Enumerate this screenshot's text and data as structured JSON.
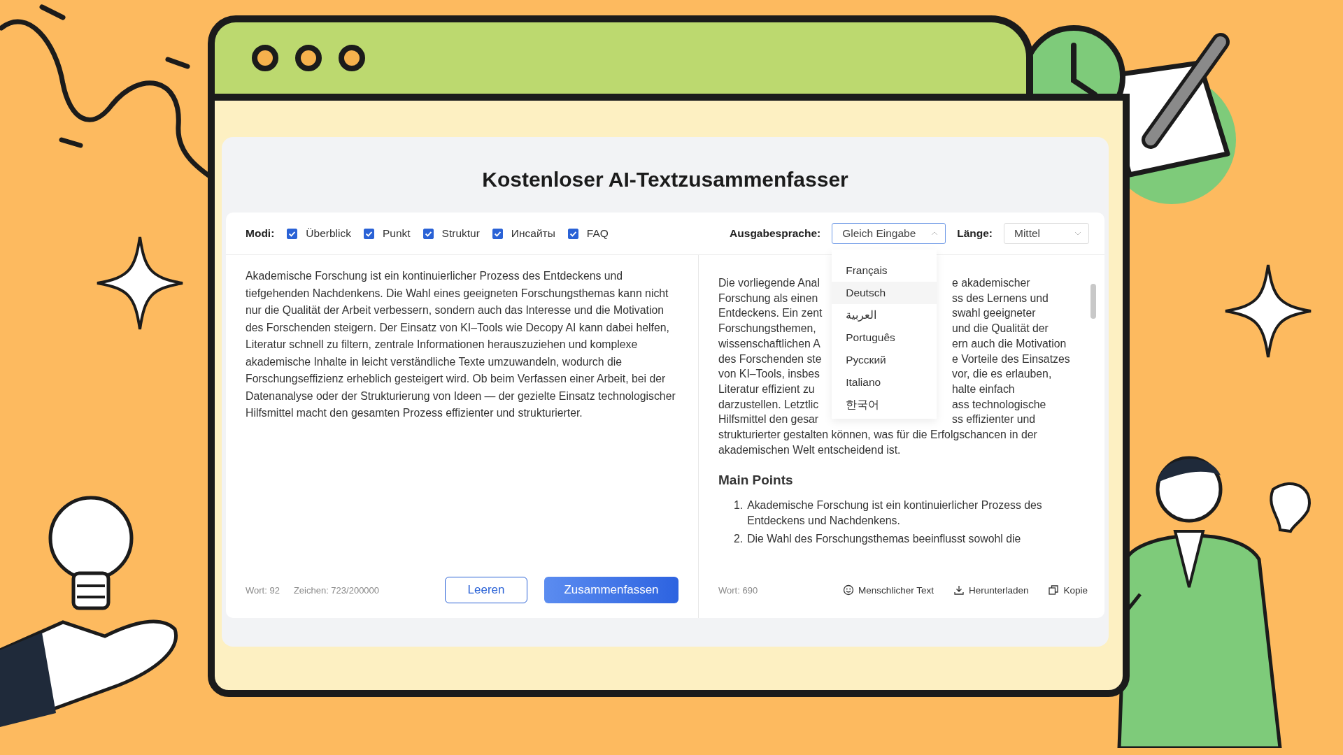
{
  "title": "Kostenloser AI-Textzusammenfasser",
  "modes": {
    "label": "Modi:",
    "items": [
      {
        "label": "Überblick",
        "checked": true
      },
      {
        "label": "Punkt",
        "checked": true
      },
      {
        "label": "Struktur",
        "checked": true
      },
      {
        "label": "Инсайты",
        "checked": true
      },
      {
        "label": "FAQ",
        "checked": true
      }
    ]
  },
  "output_language": {
    "label": "Ausgabesprache:",
    "value": "Gleich Eingabe",
    "expanded": true,
    "options": [
      {
        "label": "Français",
        "selected": false
      },
      {
        "label": "Deutsch",
        "selected": true
      },
      {
        "label": "العربية",
        "selected": false
      },
      {
        "label": "Português",
        "selected": false
      },
      {
        "label": "Русский",
        "selected": false
      },
      {
        "label": "Italiano",
        "selected": false
      },
      {
        "label": "한국어",
        "selected": false
      }
    ]
  },
  "length": {
    "label": "Länge:",
    "value": "Mittel",
    "expanded": false
  },
  "input": {
    "text": "Akademische Forschung ist ein kontinuierlicher Prozess des Entdeckens und tiefgehenden Nachdenkens. Die Wahl eines geeigneten Forschungsthemas kann nicht nur die Qualität der Arbeit verbessern, sondern auch das Interesse und die Motivation des Forschenden steigern. Der Einsatz von KI–Tools wie Decopy AI kann dabei helfen, Literatur schnell zu filtern, zentrale Informationen herauszuziehen und komplexe akademische Inhalte in leicht verständliche Texte umzuwandeln, wodurch die Forschungseffizienz erheblich gesteigert wird. Ob beim Verfassen einer Arbeit, bei der Datenanalyse oder der Strukturierung von Ideen — der gezielte Einsatz technologischer Hilfsmittel macht den gesamten Prozess effizienter und strukturierter.",
    "word_count": "Wort: 92",
    "char_count": "Zeichen: 723/200000",
    "buttons": [
      {
        "label": "Leeren",
        "kind": "secondary"
      },
      {
        "label": "Zusammenfassen",
        "kind": "primary"
      }
    ]
  },
  "output": {
    "summary_lines": [
      {
        "left": "Die vorliegende Anal",
        "right": "e akademischer"
      },
      {
        "left": "Forschung als einen",
        "right": "ss des Lernens und"
      },
      {
        "left": "Entdeckens. Ein zent",
        "right": "swahl geeigneter"
      },
      {
        "left": "Forschungsthemen,",
        "right": "und die Qualität der"
      },
      {
        "left": "wissenschaftlichen A",
        "right": "ern auch die Motivation"
      },
      {
        "left": "des Forschenden ste",
        "right": "e Vorteile des Einsatzes"
      },
      {
        "left": "von KI–Tools, insbes",
        "right": "vor, die es erlauben,"
      },
      {
        "left": "Literatur effizient zu",
        "right": "halte einfach"
      },
      {
        "left": "darzustellen. Letztlic",
        "right": "ass technologische"
      },
      {
        "left": "Hilfsmittel den gesar",
        "right": "ss effizienter und"
      },
      {
        "text": "strukturierter gestalten können, was für die Erfolgschancen in der"
      },
      {
        "text": "akademischen Welt entscheidend ist."
      }
    ],
    "heading": "Main Points",
    "points": [
      {
        "number": "1.",
        "text": "Akademische Forschung ist ein kontinuierlicher Prozess des Entdeckens und Nachdenkens."
      },
      {
        "number": "2.",
        "text": "Die Wahl des Forschungsthemas beeinflusst sowohl die"
      }
    ],
    "word_count": "Wort: 690",
    "actions": [
      {
        "label": "Menschlicher Text",
        "kind": "humanize"
      },
      {
        "label": "Herunterladen",
        "kind": "download"
      },
      {
        "label": "Kopie",
        "kind": "copy"
      }
    ]
  }
}
